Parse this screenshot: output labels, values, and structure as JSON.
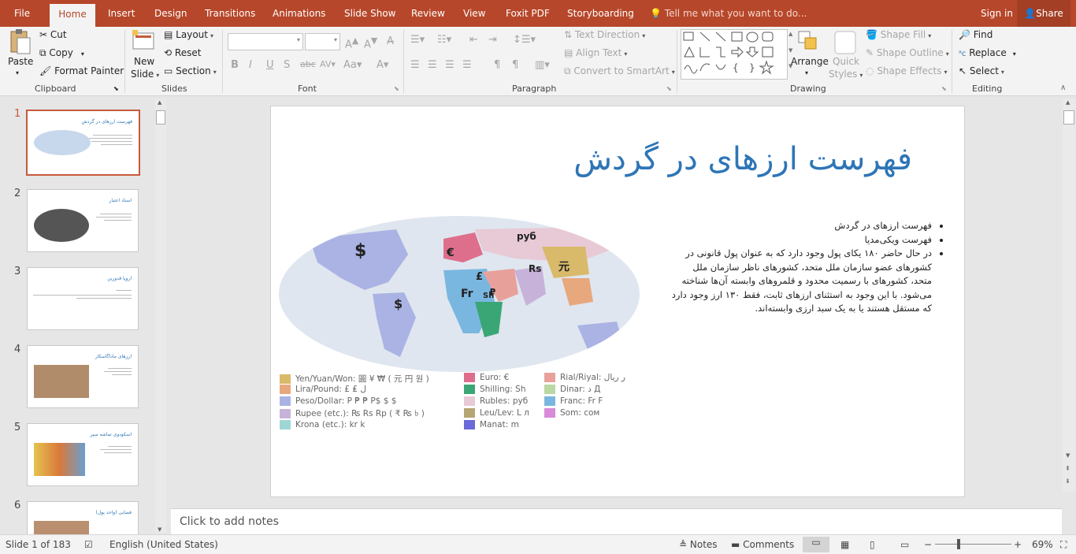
{
  "menu": {
    "tabs": [
      "File",
      "Home",
      "Insert",
      "Design",
      "Transitions",
      "Animations",
      "Slide Show",
      "Review",
      "View",
      "Foxit PDF",
      "Storyboarding"
    ],
    "active_tab": "Home",
    "tell_me": "Tell me what you want to do...",
    "sign_in": "Sign in",
    "share": "Share"
  },
  "ribbon": {
    "clipboard": {
      "paste": "Paste",
      "cut": "Cut",
      "copy": "Copy",
      "format_painter": "Format Painter",
      "label": "Clipboard"
    },
    "slides": {
      "new_slide_1": "New",
      "new_slide_2": "Slide",
      "layout": "Layout",
      "reset": "Reset",
      "section": "Section",
      "label": "Slides"
    },
    "font": {
      "label": "Font"
    },
    "paragraph": {
      "text_direction": "Text Direction",
      "align_text": "Align Text",
      "convert_smartart": "Convert to SmartArt",
      "label": "Paragraph"
    },
    "drawing": {
      "arrange": "Arrange",
      "quick_styles_1": "Quick",
      "quick_styles_2": "Styles",
      "shape_fill": "Shape Fill",
      "shape_outline": "Shape Outline",
      "shape_effects": "Shape Effects",
      "label": "Drawing"
    },
    "editing": {
      "find": "Find",
      "replace": "Replace",
      "select": "Select",
      "label": "Editing"
    }
  },
  "thumbnails": [
    {
      "num": "1",
      "title": "فهرست ارزهای در گردش"
    },
    {
      "num": "2",
      "title": "اسناد اعتبار"
    },
    {
      "num": "3",
      "title": "اروپا فدورین"
    },
    {
      "num": "4",
      "title": "ارزهای ماداگاسکار"
    },
    {
      "num": "5",
      "title": "اسکودوی تماشه سپر"
    },
    {
      "num": "6",
      "title": "فضایی (واحد پول)"
    }
  ],
  "slide": {
    "title": "فهرست ارزهای در گردش",
    "bullets": [
      "فهرست ارزهای در گردش",
      "فهرست ویکی‌مدیا",
      "در حال حاضر ۱۸۰ یکای پول وجود دارد که به عنوان پول قانونی در کشورهای عضو سازمان ملل متحد، کشورهای ناظر سازمان ملل متحد، کشورهای با رسمیت محدود و قلمروهای وابسته آن‌ها شناخته می‌شود. با این وجود به استثنای ارزهای ثابت، فقط ۱۳۰ ارز وجود دارد که مستقل هستند یا به یک سبد ارزی وابسته‌اند."
    ],
    "map_labels": [
      "$",
      "$",
      "Fr",
      "€",
      "£",
      "руб",
      "元",
      "₽",
      "Sh",
      "Rs"
    ],
    "legend": [
      {
        "color": "#d9b96a",
        "label": "Yen/Yuan/Won: 圓 ¥ ₩ ( 元 円 원 )"
      },
      {
        "color": "#e8a87e",
        "label": "Lira/Pound: £ ₤ ل"
      },
      {
        "color": "#aab3e3",
        "label": "Peso/Dollar: P ₱ ₱ P$ $ $"
      },
      {
        "color": "#c7b3d9",
        "label": "Rupee (etc.): ₨ Rs Rp ( ₹ ₨ ৳ )"
      },
      {
        "color": "#9ed6d4",
        "label": "Krona (etc.): kr k"
      },
      {
        "color": "#de6f8c",
        "label": "Euro: €"
      },
      {
        "color": "#3aa676",
        "label": "Shilling: Sh"
      },
      {
        "color": "#e8c9d6",
        "label": "Rubles: руб"
      },
      {
        "color": "#b5a673",
        "label": "Leu/Lev: L л"
      },
      {
        "color": "#6a6ad9",
        "label": "Manat: m"
      },
      {
        "color": "#e8a19a",
        "label": "Rial/Riyal: ر ریال"
      },
      {
        "color": "#b9d8a4",
        "label": "Dinar: د Д"
      },
      {
        "color": "#7ab7e0",
        "label": "Franc: Fr F"
      },
      {
        "color": "#d98ad9",
        "label": "Som: сом"
      }
    ]
  },
  "notes_placeholder": "Click to add notes",
  "status": {
    "slide_info": "Slide 1 of 183",
    "language": "English (United States)",
    "notes": "Notes",
    "comments": "Comments",
    "zoom": "69%"
  }
}
